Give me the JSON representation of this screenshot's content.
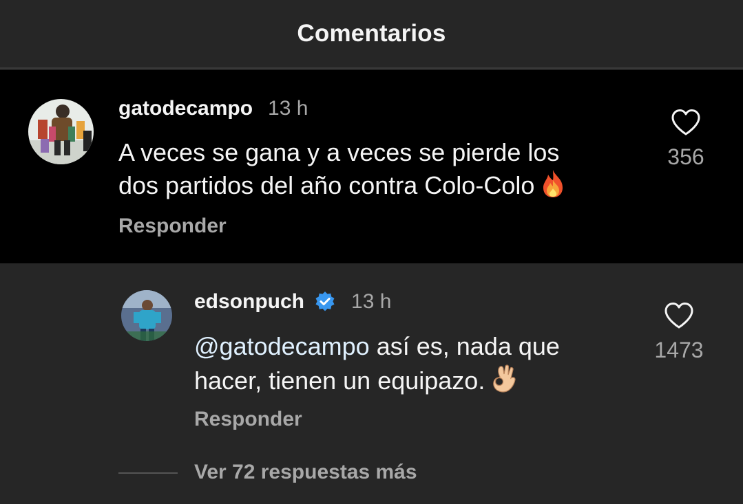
{
  "header": {
    "title": "Comentarios"
  },
  "comments": [
    {
      "username": "gatodecampo",
      "time": "13 h",
      "text_line1": "A veces se gana y a veces se pierde los",
      "text_line2": "dos partidos del año contra Colo-Colo",
      "emoji": "fire-icon",
      "reply_label": "Responder",
      "likes": "356"
    }
  ],
  "replies": [
    {
      "username": "edsonpuch",
      "verified": true,
      "time": "13 h",
      "mention": "@gatodecampo",
      "text_line1": " así es, nada que",
      "text_line2": "hacer, tienen un equipazo.",
      "emoji": "ok-hand-icon",
      "reply_label": "Responder",
      "likes": "1473"
    }
  ],
  "more_replies_label": "Ver 72 respuestas más",
  "colors": {
    "background": "#262626",
    "highlight_background": "#000000",
    "text_primary": "#f5f5f5",
    "text_secondary": "#a8a8a8",
    "verified_blue": "#3897f0",
    "mention": "#e0f1ff"
  }
}
